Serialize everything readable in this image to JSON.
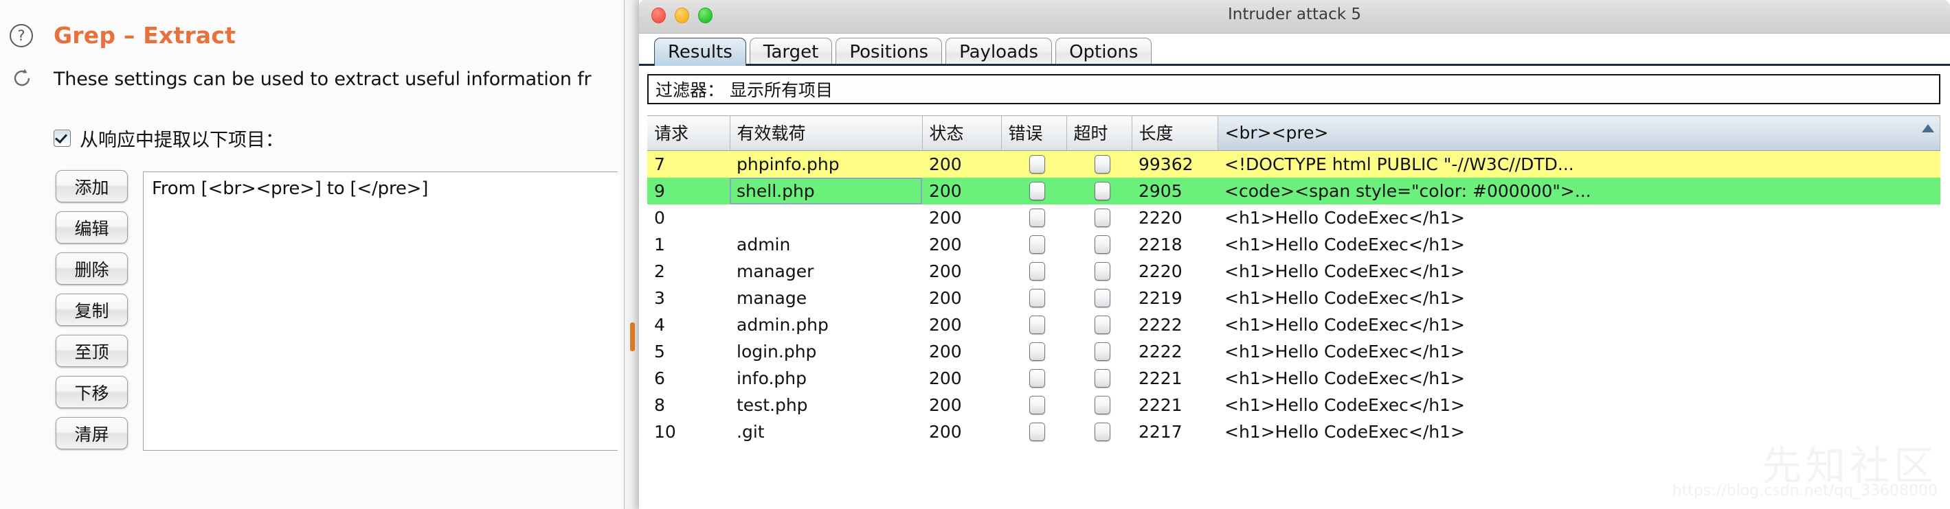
{
  "left_panel": {
    "title": "Grep – Extract",
    "description": "These settings can be used to extract useful information fr",
    "help_icon": "question-mark-icon",
    "refresh_icon": "refresh-icon",
    "extract_checkbox": {
      "checked": true,
      "label": "从响应中提取以下项目："
    },
    "buttons": [
      {
        "label": "添加",
        "name": "add-button"
      },
      {
        "label": "编辑",
        "name": "edit-button"
      },
      {
        "label": "删除",
        "name": "delete-button"
      },
      {
        "label": "复制",
        "name": "duplicate-button"
      },
      {
        "label": "至顶",
        "name": "move-top-button"
      },
      {
        "label": "下移",
        "name": "move-down-button"
      },
      {
        "label": "清屏",
        "name": "clear-button"
      }
    ],
    "grep_items": [
      "From [<br><pre>] to [</pre>]"
    ],
    "scrollbar_color": "#e07b28"
  },
  "window": {
    "title": "Intruder attack 5",
    "traffic_lights": [
      "close-button",
      "minimize-button",
      "zoom-button"
    ],
    "tabs": [
      {
        "label": "Results",
        "active": true
      },
      {
        "label": "Target",
        "active": false
      },
      {
        "label": "Positions",
        "active": false
      },
      {
        "label": "Payloads",
        "active": false
      },
      {
        "label": "Options",
        "active": false
      }
    ],
    "filter": {
      "label": "过滤器：",
      "value": "显示所有项目"
    },
    "table": {
      "columns": [
        {
          "label": "请求",
          "name": "column-request"
        },
        {
          "label": "有效载荷",
          "name": "column-payload"
        },
        {
          "label": "状态",
          "name": "column-status"
        },
        {
          "label": "错误",
          "name": "column-error"
        },
        {
          "label": "超时",
          "name": "column-timeout"
        },
        {
          "label": "长度",
          "name": "column-length"
        },
        {
          "label": "<br><pre>",
          "name": "column-grep-extract",
          "sorted": "asc"
        }
      ],
      "rows": [
        {
          "request": "7",
          "payload": "phpinfo.php",
          "status": "200",
          "error": false,
          "timeout": false,
          "length": "99362",
          "extract": "<!DOCTYPE html PUBLIC \"-//W3C//DTD...",
          "highlight": "yellow",
          "selected": false
        },
        {
          "request": "9",
          "payload": "shell.php",
          "status": "200",
          "error": false,
          "timeout": false,
          "length": "2905",
          "extract": "<code><span style=\"color: #000000\">...",
          "highlight": "green",
          "selected": true
        },
        {
          "request": "0",
          "payload": "",
          "status": "200",
          "error": false,
          "timeout": false,
          "length": "2220",
          "extract": "<h1>Hello CodeExec</h1>",
          "highlight": "white",
          "selected": false
        },
        {
          "request": "1",
          "payload": "admin",
          "status": "200",
          "error": false,
          "timeout": false,
          "length": "2218",
          "extract": "<h1>Hello CodeExec</h1>",
          "highlight": "white",
          "selected": false
        },
        {
          "request": "2",
          "payload": "manager",
          "status": "200",
          "error": false,
          "timeout": false,
          "length": "2220",
          "extract": "<h1>Hello CodeExec</h1>",
          "highlight": "white",
          "selected": false
        },
        {
          "request": "3",
          "payload": "manage",
          "status": "200",
          "error": false,
          "timeout": false,
          "length": "2219",
          "extract": "<h1>Hello CodeExec</h1>",
          "highlight": "white",
          "selected": false
        },
        {
          "request": "4",
          "payload": "admin.php",
          "status": "200",
          "error": false,
          "timeout": false,
          "length": "2222",
          "extract": "<h1>Hello CodeExec</h1>",
          "highlight": "white",
          "selected": false
        },
        {
          "request": "5",
          "payload": "login.php",
          "status": "200",
          "error": false,
          "timeout": false,
          "length": "2222",
          "extract": "<h1>Hello CodeExec</h1>",
          "highlight": "white",
          "selected": false
        },
        {
          "request": "6",
          "payload": "info.php",
          "status": "200",
          "error": false,
          "timeout": false,
          "length": "2221",
          "extract": "<h1>Hello CodeExec</h1>",
          "highlight": "white",
          "selected": false
        },
        {
          "request": "8",
          "payload": "test.php",
          "status": "200",
          "error": false,
          "timeout": false,
          "length": "2221",
          "extract": "<h1>Hello CodeExec</h1>",
          "highlight": "white",
          "selected": false
        },
        {
          "request": "10",
          "payload": ".git",
          "status": "200",
          "error": false,
          "timeout": false,
          "length": "2217",
          "extract": "<h1>Hello CodeExec</h1>",
          "highlight": "white",
          "selected": false
        }
      ]
    }
  },
  "watermark": {
    "text": "先知社区",
    "url": "https://blog.csdn.net/qq_33608000"
  },
  "colors": {
    "accent_orange": "#e8703a",
    "row_yellow": "#fdfd86",
    "row_green": "#6cf07c",
    "scrollbar_orange": "#e07b28"
  }
}
